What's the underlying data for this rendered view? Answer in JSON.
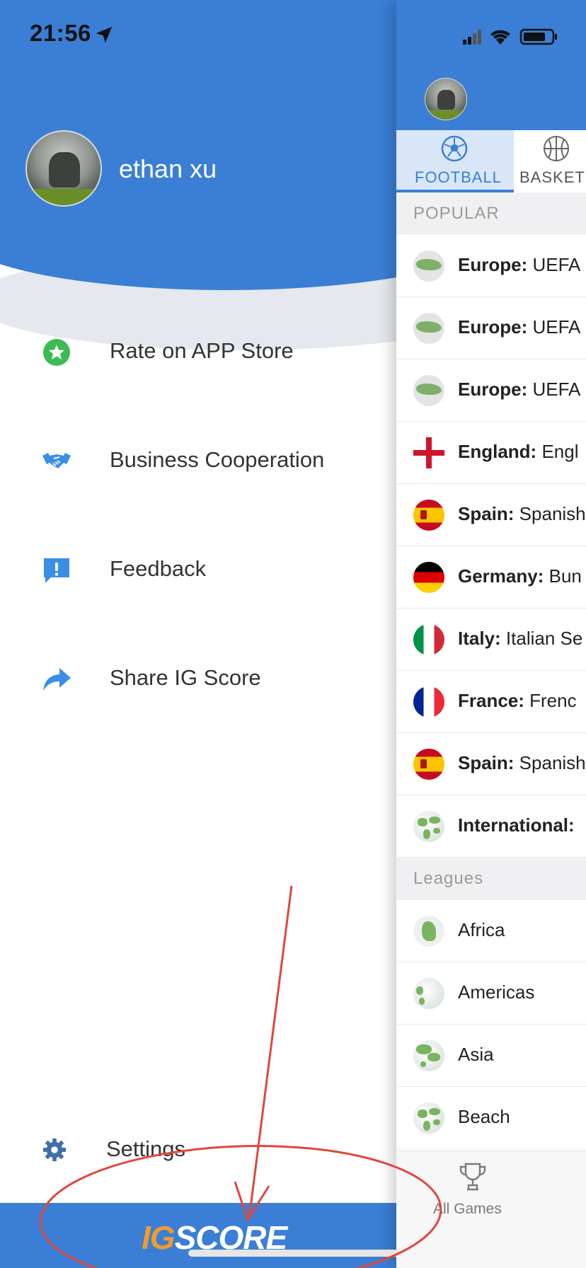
{
  "status_bar": {
    "time": "21:56"
  },
  "drawer": {
    "username": "ethan xu",
    "menu": [
      {
        "label": "Rate on APP Store",
        "icon": "star-badge-icon"
      },
      {
        "label": "Business Cooperation",
        "icon": "handshake-icon"
      },
      {
        "label": "Feedback",
        "icon": "feedback-icon"
      },
      {
        "label": "Share IG Score",
        "icon": "share-arrow-icon"
      }
    ],
    "settings_label": "Settings",
    "brand": {
      "ig": "IG",
      "score": "SCORE"
    }
  },
  "main": {
    "tabs": [
      {
        "label": "FOOTBALL",
        "active": true
      },
      {
        "label": "BASKET"
      }
    ],
    "popular_header": "POPULAR",
    "popular": [
      {
        "country": "Europe:",
        "league": " UEFA"
      },
      {
        "country": "Europe:",
        "league": " UEFA"
      },
      {
        "country": "Europe:",
        "league": " UEFA"
      },
      {
        "country": "England:",
        "league": " Engl"
      },
      {
        "country": "Spain:",
        "league": " Spanish"
      },
      {
        "country": "Germany:",
        "league": " Bun"
      },
      {
        "country": "Italy:",
        "league": " Italian Se"
      },
      {
        "country": "France:",
        "league": " Frenc"
      },
      {
        "country": "Spain:",
        "league": " Spanish"
      },
      {
        "country": "International:",
        "league": ""
      }
    ],
    "leagues_header": "Leagues",
    "leagues": [
      {
        "label": "Africa"
      },
      {
        "label": "Americas"
      },
      {
        "label": "Asia"
      },
      {
        "label": "Beach"
      }
    ],
    "bottom_nav": {
      "all_games": "All Games"
    }
  },
  "colors": {
    "primary_blue": "#3a7fd5",
    "brand_orange": "#f29a2e",
    "annotation_red": "#e2463c"
  }
}
